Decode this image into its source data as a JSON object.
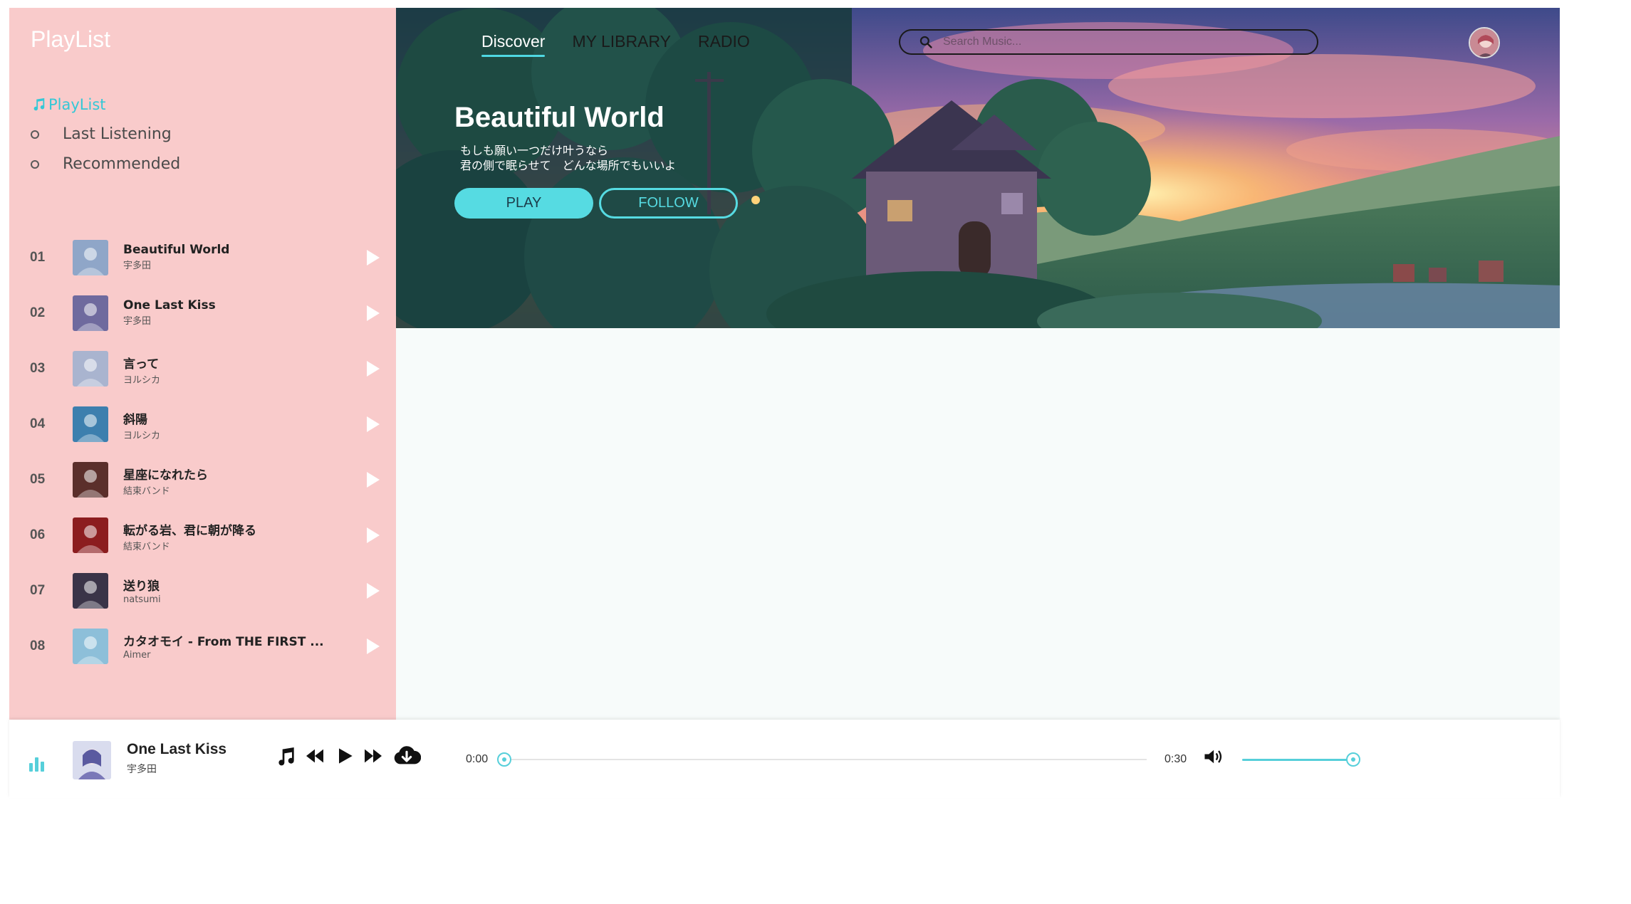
{
  "app": {
    "brand": "PlayList"
  },
  "sidebar": {
    "heading": "PlayList",
    "nav": [
      {
        "label": "Last Listening"
      },
      {
        "label": "Recommended"
      }
    ]
  },
  "tracks": [
    {
      "num": "01",
      "title": "Beautiful World",
      "artist": "宇多田",
      "cover_color": "#8fa6c8"
    },
    {
      "num": "02",
      "title": "One Last Kiss",
      "artist": "宇多田",
      "cover_color": "#6f6a9e"
    },
    {
      "num": "03",
      "title": "言って",
      "artist": "ヨルシカ",
      "cover_color": "#a9b4cf"
    },
    {
      "num": "04",
      "title": "斜陽",
      "artist": "ヨルシカ",
      "cover_color": "#3d7fae"
    },
    {
      "num": "05",
      "title": "星座になれたら",
      "artist": "結束バンド",
      "cover_color": "#5b2f2b"
    },
    {
      "num": "06",
      "title": "転がる岩、君に朝が降る",
      "artist": "結束バンド",
      "cover_color": "#8c1d1f"
    },
    {
      "num": "07",
      "title": "送り狼",
      "artist": "natsumi",
      "cover_color": "#3a3448"
    },
    {
      "num": "08",
      "title": "カタオモイ - From THE FIRST ...",
      "artist": "Aimer",
      "cover_color": "#8dbfd9"
    }
  ],
  "header": {
    "tabs": [
      {
        "label": "Discover",
        "active": true
      },
      {
        "label": "MY LIBRARY",
        "active": false
      },
      {
        "label": "RADIO",
        "active": false
      }
    ],
    "search_placeholder": "Search Music..."
  },
  "hero": {
    "title": "Beautiful World",
    "lyric_line_1": "もしも願い一つだけ叶うなら",
    "lyric_line_2": "君の側で眠らせて　どんな場所でもいいよ",
    "play_label": "PLAY",
    "follow_label": "FOLLOW"
  },
  "player": {
    "title": "One Last Kiss",
    "artist": "宇多田",
    "current_time": "0:00",
    "total_time": "0:30",
    "progress": 0,
    "volume": 1.0,
    "icons": [
      "equalizer-icon",
      "music-note-icon",
      "rewind-icon",
      "play-icon",
      "fast-forward-icon",
      "cloud-download-icon",
      "volume-icon"
    ]
  },
  "colors": {
    "accent": "#56dbe2",
    "sidebar_bg": "#f9cbcb",
    "main_bg": "#f7fbfa"
  }
}
